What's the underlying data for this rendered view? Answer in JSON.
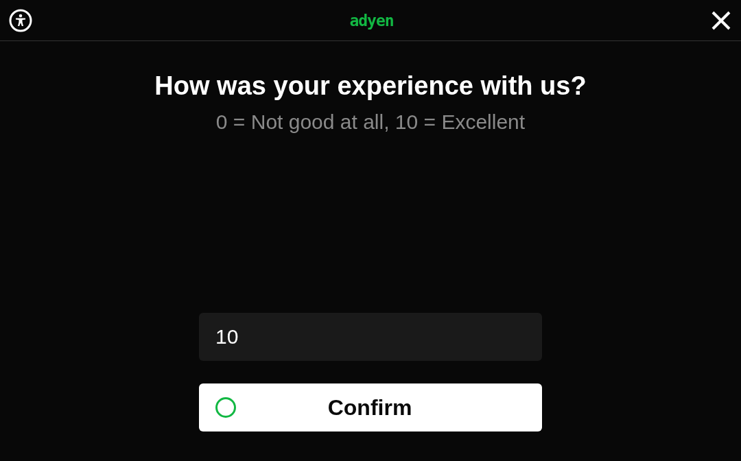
{
  "header": {
    "logo": "adyen"
  },
  "question": {
    "title": "How was your experience with us?",
    "hint": "0 = Not good at all, 10 = Excellent"
  },
  "score_field": {
    "value": "10"
  },
  "confirm_button": {
    "label": "Confirm"
  }
}
